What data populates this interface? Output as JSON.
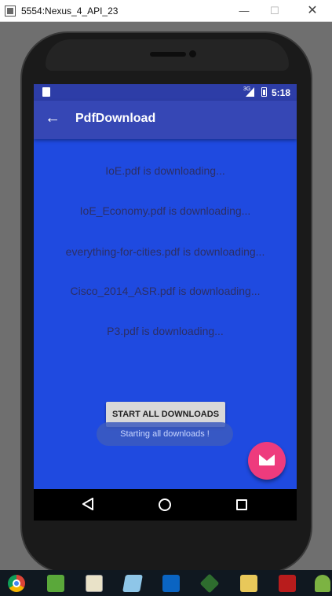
{
  "window": {
    "title": "5554:Nexus_4_API_23",
    "minimize_glyph": "—",
    "maximize_glyph": "☐",
    "close_glyph": "✕"
  },
  "statusbar": {
    "network_label": "3G",
    "time": "5:18"
  },
  "appbar": {
    "back_glyph": "←",
    "title": "PdfDownload"
  },
  "downloads": [
    "IoE.pdf is downloading...",
    "IoE_Economy.pdf is downloading...",
    "everything-for-cities.pdf is downloading...",
    "Cisco_2014_ASR.pdf is downloading...",
    "P3.pdf is downloading..."
  ],
  "start_button": {
    "label": "START ALL DOWNLOADS"
  },
  "toast": {
    "message": "Starting all downloads !"
  },
  "fab": {
    "icon": "mail-icon",
    "color": "#ee3b7d"
  },
  "colors": {
    "screen_bg": "#1f4ae0",
    "appbar_bg": "#3647b5",
    "statusbar_bg": "#2d3da7"
  },
  "taskbar": {
    "icons": [
      "chrome-icon",
      "evernote-icon",
      "chart-icon",
      "notebook-icon",
      "outlook-icon",
      "git-icon",
      "folder-icon",
      "acrobat-icon",
      "android-icon"
    ]
  }
}
